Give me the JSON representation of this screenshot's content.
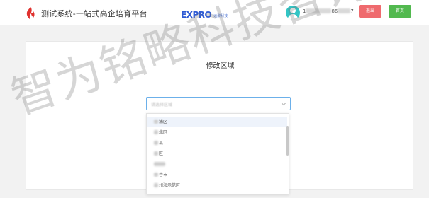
{
  "header": {
    "app_title": "测试系统-一站式高企培育平台",
    "logo_icon": "flame-logo-icon",
    "brand": {
      "main": "EXPRO",
      "sub": "远聚科技"
    },
    "avatar_icon": "user-avatar-icon",
    "username_start": "1",
    "username_mid": "86",
    "username_end": "7",
    "logout_label": "退出",
    "home_label": "首页"
  },
  "colors": {
    "brand_blue": "#2f5bd3",
    "avatar_teal": "#32c5c5",
    "logout_red": "#ef6a6e",
    "home_green": "#52b94f",
    "focus_border": "#6cb0ea"
  },
  "main": {
    "title": "修改区域",
    "select": {
      "placeholder": "请选择区域",
      "dropdown_icon": "chevron-down-icon"
    },
    "dropdown_items": [
      {
        "label": "浦区"
      },
      {
        "label": "北区"
      },
      {
        "label": "县"
      },
      {
        "label": "区"
      },
      {
        "label": ""
      },
      {
        "label": "谷市"
      },
      {
        "label": "州海示范区"
      }
    ]
  },
  "watermark": "智为铭略科技咨询"
}
